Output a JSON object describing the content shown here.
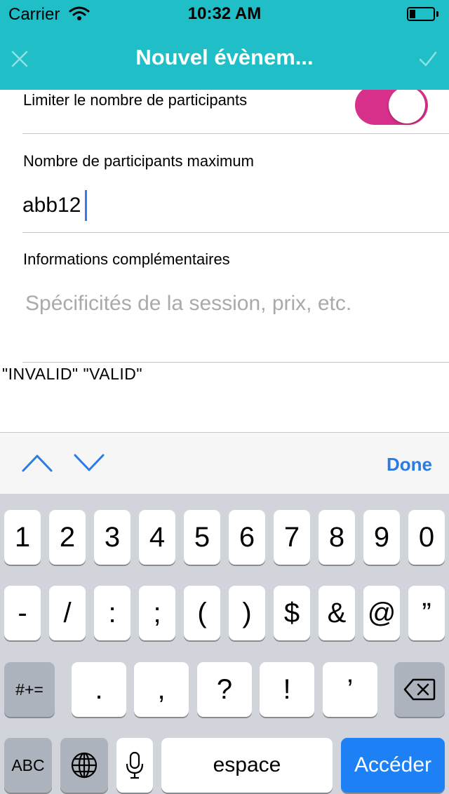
{
  "status_bar": {
    "carrier": "Carrier",
    "time": "10:32 AM",
    "wifi_icon": "wifi-icon",
    "battery_icon": "battery-icon"
  },
  "nav": {
    "title": "Nouvel évènem...",
    "close_icon": "close-icon",
    "confirm_icon": "checkmark-icon",
    "background_color": "#20BEC6"
  },
  "form": {
    "limit_participants_label": "Limiter le nombre de participants",
    "limit_participants_toggle": "on",
    "toggle_color": "#D8318C",
    "max_participants_label": "Nombre de participants maximum",
    "max_participants_value": "abb12",
    "extra_info_label": "Informations complémentaires",
    "extra_info_placeholder": "Spécificités de la session, prix, etc.",
    "validation_debug": "\"INVALID\"  \"VALID\""
  },
  "accessory": {
    "prev_icon": "chevron-up-icon",
    "next_icon": "chevron-down-icon",
    "done_label": "Done"
  },
  "keyboard": {
    "row1": [
      "1",
      "2",
      "3",
      "4",
      "5",
      "6",
      "7",
      "8",
      "9",
      "0"
    ],
    "row2": [
      "-",
      "/",
      ":",
      ";",
      "(",
      ")",
      "$",
      "&",
      "@",
      "”"
    ],
    "row3": [
      ".",
      ",",
      "?",
      "!",
      "’"
    ],
    "symbols_key": "#+=",
    "backspace_icon": "backspace-icon",
    "abc_key": "ABC",
    "globe_icon": "globe-icon",
    "mic_icon": "microphone-icon",
    "space_key": "espace",
    "go_key": "Accéder",
    "go_color": "#1E80F5"
  }
}
